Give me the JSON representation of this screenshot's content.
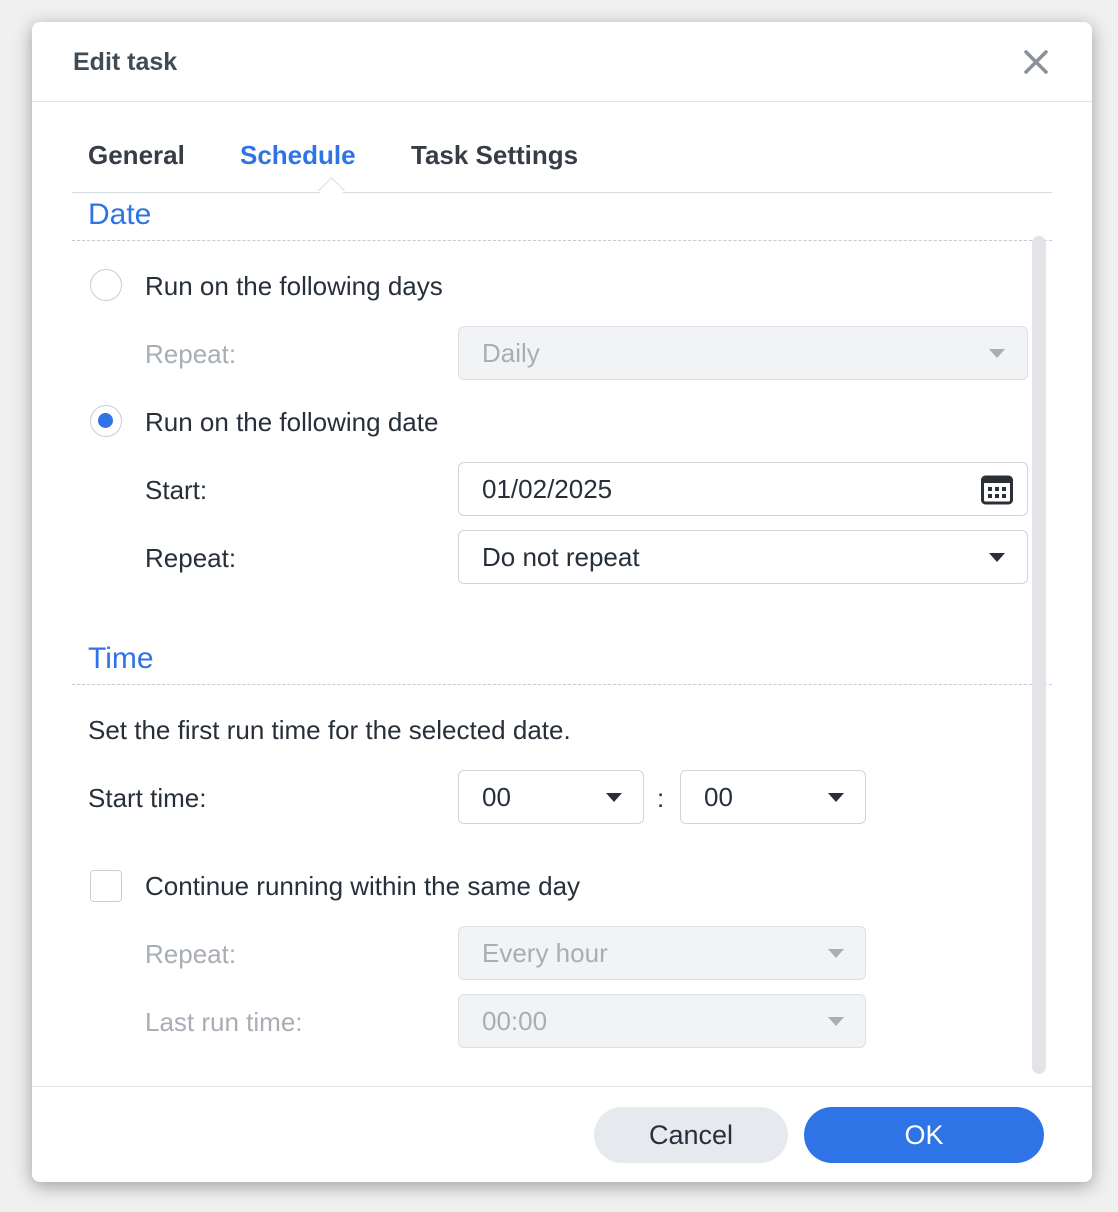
{
  "dialog": {
    "title": "Edit task",
    "close_icon": "close-icon"
  },
  "tabs": [
    {
      "label": "General",
      "active": false
    },
    {
      "label": "Schedule",
      "active": true
    },
    {
      "label": "Task Settings",
      "active": false
    }
  ],
  "date_section": {
    "title": "Date",
    "option_days": {
      "label": "Run on the following days",
      "checked": false
    },
    "days_repeat": {
      "label": "Repeat:",
      "value": "Daily",
      "disabled": true
    },
    "option_date": {
      "label": "Run on the following date",
      "checked": true
    },
    "start": {
      "label": "Start:",
      "value": "01/02/2025",
      "icon": "calendar-icon"
    },
    "date_repeat": {
      "label": "Repeat:",
      "value": "Do not repeat"
    }
  },
  "time_section": {
    "title": "Time",
    "description": "Set the first run time for the selected date.",
    "start_time": {
      "label": "Start time:",
      "hour": "00",
      "separator": ":",
      "minute": "00"
    },
    "continue": {
      "label": "Continue running within the same day",
      "checked": false
    },
    "repeat": {
      "label": "Repeat:",
      "value": "Every hour",
      "disabled": true
    },
    "last_run": {
      "label": "Last run time:",
      "value": "00:00",
      "disabled": true
    }
  },
  "footer": {
    "cancel_label": "Cancel",
    "ok_label": "OK"
  },
  "colors": {
    "accent": "#2f74e6",
    "title_text": "#414b55",
    "disabled_text": "#a8aeb5"
  }
}
